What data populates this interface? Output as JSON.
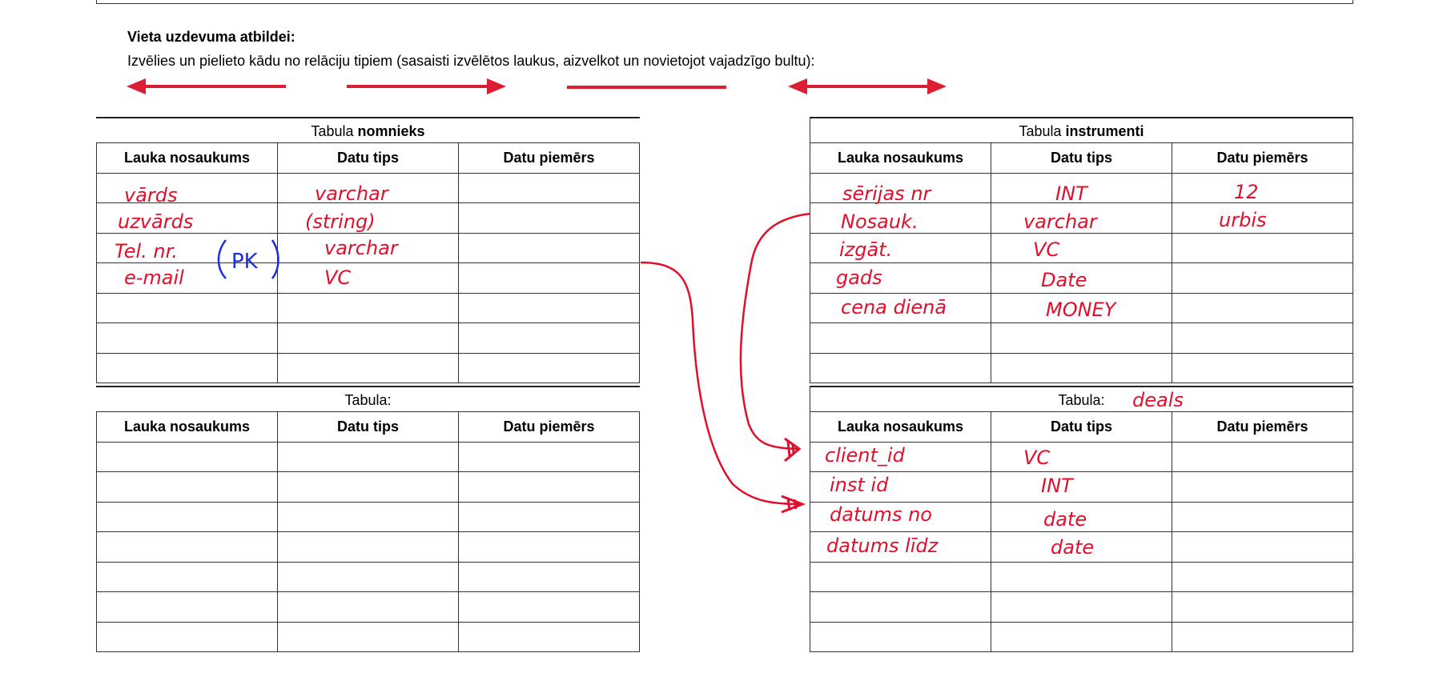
{
  "header": {
    "title": "Vieta uzdevuma atbildei:",
    "instruction": "Izvēlies un pielieto kādu no relāciju tipiem (sasaisti izvēlētos laukus, aizvelkot un novietojot vajadzīgo bultu):"
  },
  "arrow_tools": [
    "left-arrow",
    "right-arrow",
    "plain-line",
    "double-arrow"
  ],
  "colors": {
    "accent": "#dc1e35",
    "handwriting": "#e0102a",
    "pk_mark": "#1a2ee0",
    "grid": "#333333"
  },
  "columns": [
    "Lauka nosaukums",
    "Datu tips",
    "Datu piemērs"
  ],
  "tables": {
    "top_left": {
      "prefix": "Tabula ",
      "name": "nomnieks"
    },
    "top_right": {
      "prefix": "Tabula ",
      "name": "instrumenti"
    },
    "bottom_left": {
      "prefix": "Tabula:",
      "name": ""
    },
    "bottom_right": {
      "prefix": "Tabula:",
      "name": ""
    }
  },
  "handwriting": {
    "nomnieks": {
      "fields": [
        "vārds",
        "uzvārds",
        "Tel. nr.",
        "e-mail"
      ],
      "types": [
        "varchar",
        "(string)",
        "varchar",
        "VC"
      ],
      "pk_mark": "PK"
    },
    "instruments": {
      "fields": [
        "sērijas nr",
        "Nosauk.",
        "izgāt.",
        "gads",
        "cena dienā"
      ],
      "types": [
        "INT",
        "varchar",
        "VC",
        "Date",
        "MONEY"
      ],
      "examples": [
        "12",
        "urbis"
      ]
    },
    "deals": {
      "table_name": "deals",
      "fields": [
        "client_id",
        "inst id",
        "datums no",
        "datums līdz"
      ],
      "types": [
        "VC",
        "INT",
        "date",
        "date"
      ]
    }
  }
}
